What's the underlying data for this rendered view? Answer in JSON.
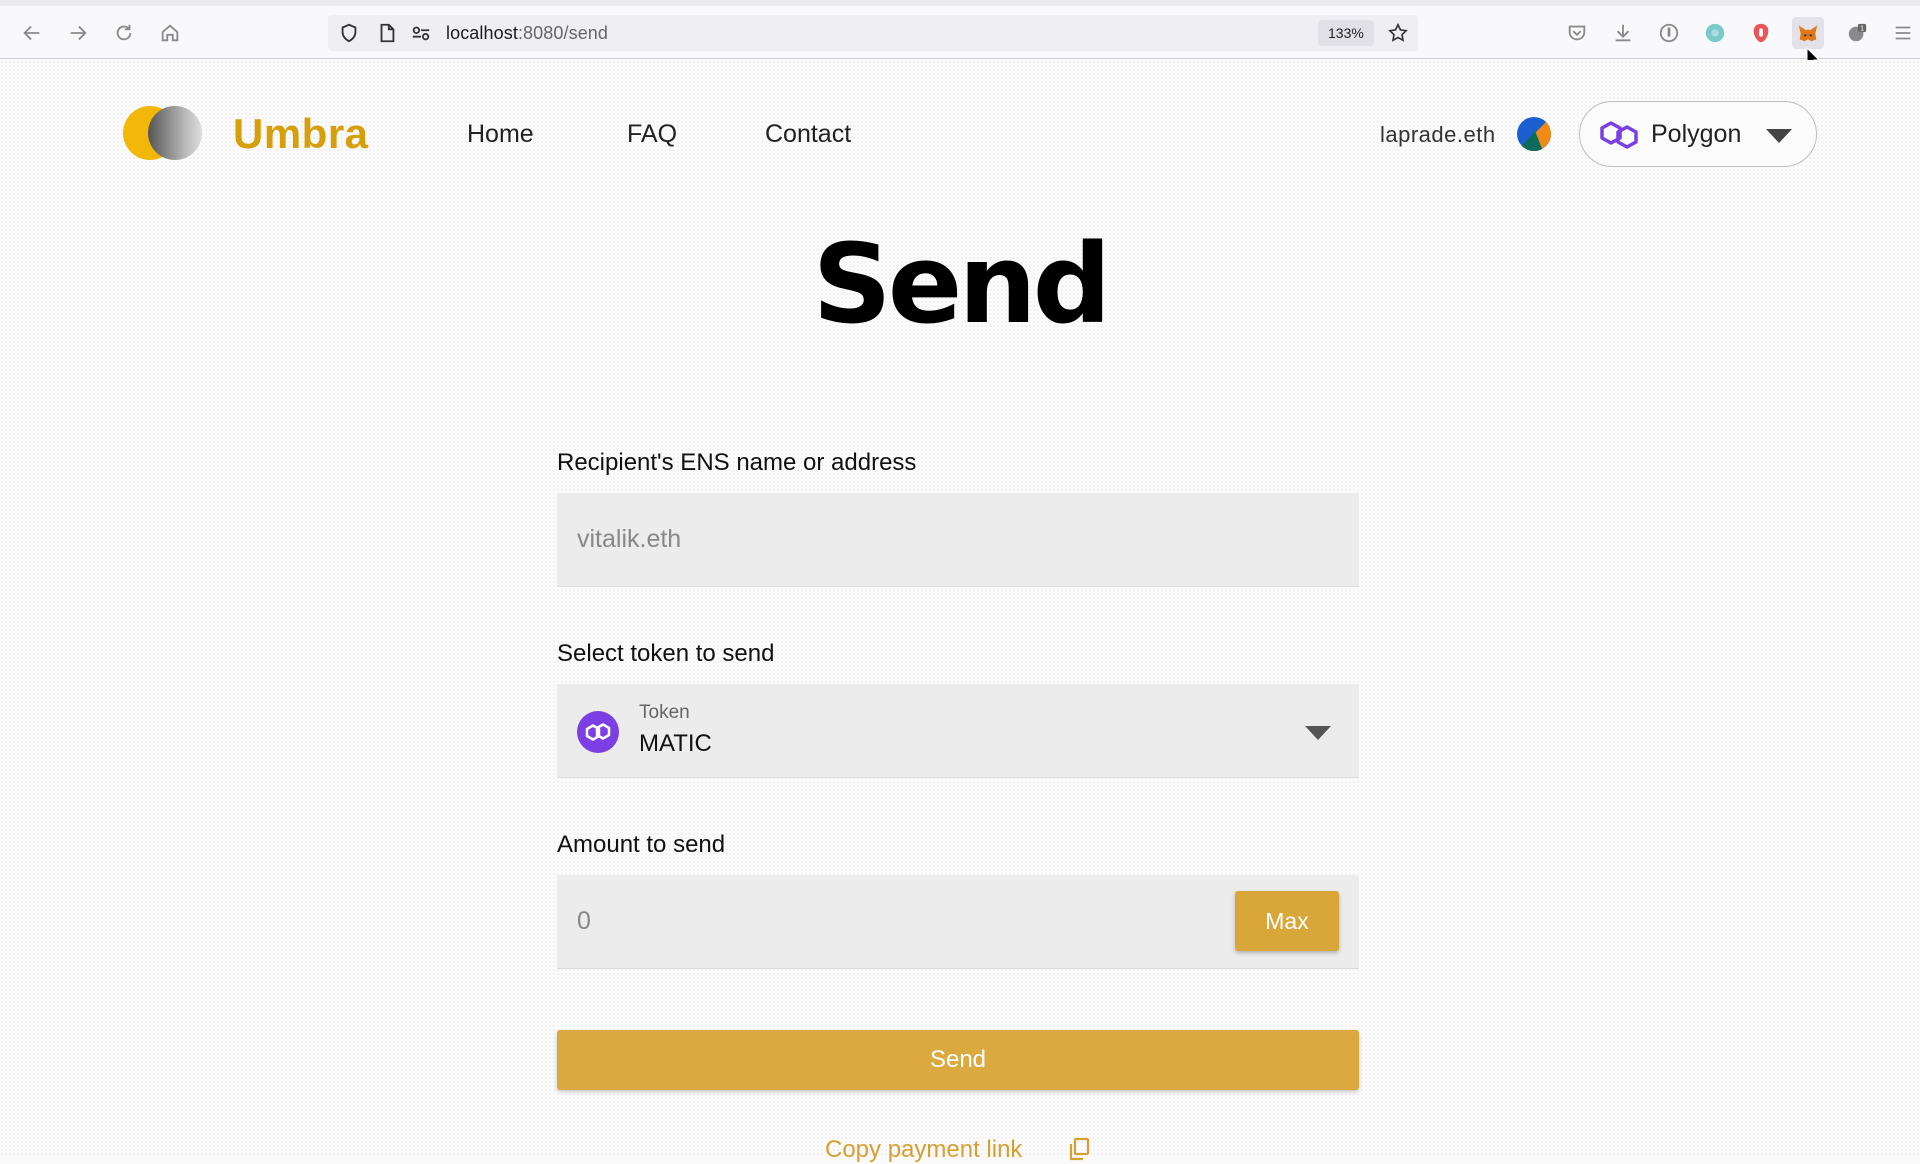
{
  "browser": {
    "url_host": "localhost",
    "url_rest": ":8080/send",
    "zoom": "133%",
    "extension_badge": "1",
    "icons": [
      "back-arrow-icon",
      "forward-arrow-icon",
      "reload-icon",
      "home-icon",
      "shield-icon",
      "page-icon",
      "connection-icon",
      "star-icon",
      "pocket-icon",
      "download-icon",
      "extension-info-icon",
      "extension-teal-icon",
      "extension-red-icon",
      "metamask-fox-icon",
      "puzzle-icon",
      "menu-icon"
    ]
  },
  "header": {
    "brand": "Umbra",
    "nav": [
      "Home",
      "FAQ",
      "Contact"
    ],
    "account": "laprade.eth",
    "network": "Polygon"
  },
  "page": {
    "title": "Send"
  },
  "form": {
    "recipient_label": "Recipient's ENS name or address",
    "recipient_placeholder": "vitalik.eth",
    "token_label": "Select token to send",
    "token_caption": "Token",
    "token_value": "MATIC",
    "amount_label": "Amount to send",
    "amount_placeholder": "0",
    "max_label": "Max",
    "send_label": "Send",
    "copy_link_label": "Copy payment link"
  },
  "colors": {
    "brand": "#d89f0d",
    "button": "#dba940",
    "polygon": "#7b3fe4"
  }
}
